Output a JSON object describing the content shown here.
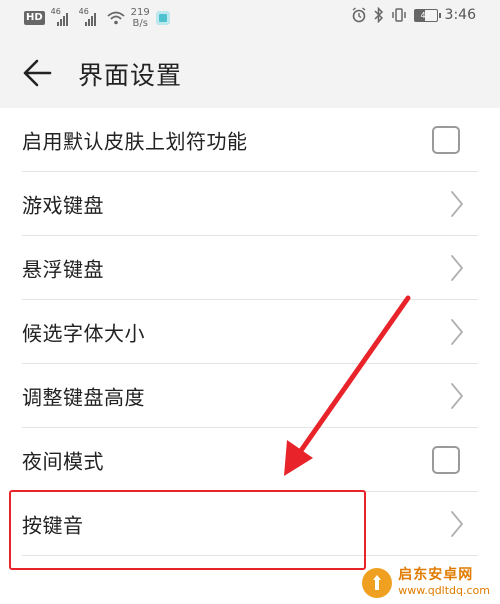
{
  "status_bar": {
    "hd": "HD",
    "sim1_tag": "46",
    "sim2_tag": "46",
    "net_speed_value": "219",
    "net_speed_unit": "B/s",
    "battery": "47",
    "time": "3:46"
  },
  "header": {
    "title": "界面设置"
  },
  "settings": [
    {
      "label": "启用默认皮肤上划符功能",
      "control": "checkbox"
    },
    {
      "label": "游戏键盘",
      "control": "chevron"
    },
    {
      "label": "悬浮键盘",
      "control": "chevron"
    },
    {
      "label": "候选字体大小",
      "control": "chevron"
    },
    {
      "label": "调整键盘高度",
      "control": "chevron"
    },
    {
      "label": "夜间模式",
      "control": "checkbox"
    },
    {
      "label": "按键音",
      "control": "chevron"
    }
  ],
  "annotation": {
    "highlight_color": "#e8242a"
  },
  "watermark": {
    "title": "启东安卓网",
    "url": "www.qdltdq.com"
  },
  "colors": {
    "header_bg": "#f3f3f3",
    "text": "#222222",
    "control_gray": "#9a9a9a",
    "highlight": "#e8242a",
    "watermark": "#e07b00"
  }
}
